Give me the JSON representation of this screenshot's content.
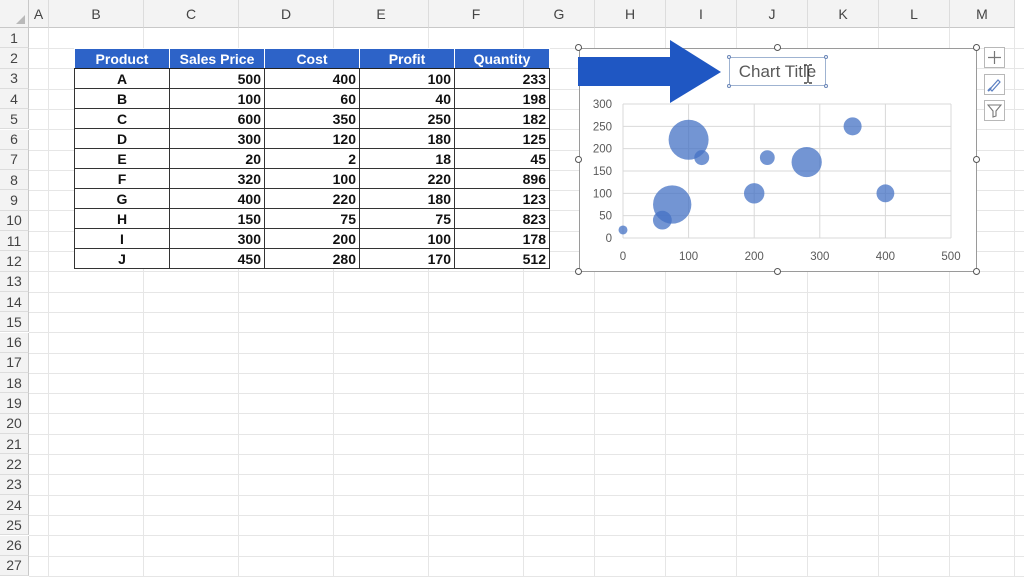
{
  "sheet": {
    "columns": [
      "A",
      "B",
      "C",
      "D",
      "E",
      "F",
      "G",
      "H",
      "I",
      "J",
      "K",
      "L",
      "M"
    ],
    "rows": [
      "1",
      "2",
      "3",
      "4",
      "5",
      "6",
      "7",
      "8",
      "9",
      "10",
      "11",
      "12",
      "13",
      "14",
      "15",
      "16",
      "17",
      "18",
      "19",
      "20",
      "21",
      "22",
      "23",
      "24",
      "25",
      "26",
      "27"
    ]
  },
  "table": {
    "headers": [
      "Product",
      "Sales Price",
      "Cost",
      "Profit",
      "Quantity"
    ],
    "rows": [
      [
        "A",
        "500",
        "400",
        "100",
        "233"
      ],
      [
        "B",
        "100",
        "60",
        "40",
        "198"
      ],
      [
        "C",
        "600",
        "350",
        "250",
        "182"
      ],
      [
        "D",
        "300",
        "120",
        "180",
        "125"
      ],
      [
        "E",
        "20",
        "2",
        "18",
        "45"
      ],
      [
        "F",
        "320",
        "100",
        "220",
        "896"
      ],
      [
        "G",
        "400",
        "220",
        "180",
        "123"
      ],
      [
        "H",
        "150",
        "75",
        "75",
        "823"
      ],
      [
        "I",
        "300",
        "200",
        "100",
        "178"
      ],
      [
        "J",
        "450",
        "280",
        "170",
        "512"
      ]
    ],
    "header_color": "#2d63c8"
  },
  "chart": {
    "title": "Chart Title",
    "bubble_color": "#4472c4",
    "arrow_color": "#1f57c3",
    "side_buttons": [
      "add-element-icon",
      "brush-icon",
      "filter-icon"
    ]
  },
  "chart_data": {
    "type": "scatter",
    "subtype": "bubble",
    "title": "Chart Title",
    "xlim": [
      0,
      500
    ],
    "ylim": [
      0,
      300
    ],
    "x_ticks": [
      "0",
      "100",
      "200",
      "300",
      "400",
      "500"
    ],
    "y_ticks": [
      "0",
      "50",
      "100",
      "150",
      "200",
      "250",
      "300"
    ],
    "grid": true,
    "legend": "none",
    "points": [
      {
        "x": 0,
        "y": 18,
        "size": 45
      },
      {
        "x": 60,
        "y": 40,
        "size": 198
      },
      {
        "x": 75,
        "y": 75,
        "size": 823
      },
      {
        "x": 100,
        "y": 220,
        "size": 896
      },
      {
        "x": 120,
        "y": 180,
        "size": 125
      },
      {
        "x": 200,
        "y": 100,
        "size": 233
      },
      {
        "x": 220,
        "y": 180,
        "size": 123
      },
      {
        "x": 280,
        "y": 170,
        "size": 512
      },
      {
        "x": 350,
        "y": 250,
        "size": 182
      },
      {
        "x": 400,
        "y": 100,
        "size": 178
      }
    ]
  }
}
